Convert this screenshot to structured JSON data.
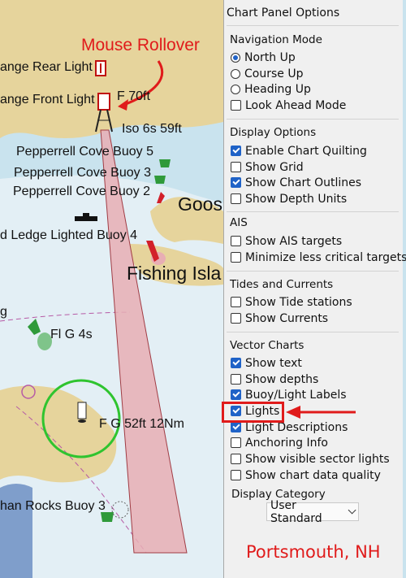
{
  "annotations": {
    "mouse_rollover": "Mouse Rollover",
    "location": "Portsmouth, NH"
  },
  "chart_labels": {
    "range_rear": "ange Rear Light",
    "range_front": "ange Front Light",
    "front_light_char": "F 70ft",
    "iso_char": "Iso 6s 59ft",
    "buoy5": "Pepperrell Cove Buoy 5",
    "buoy3": "Pepperrell Cove Buoy 3",
    "buoy2": "Pepperrell Cove Buoy 2",
    "goose": "Goos",
    "ledge_buoy": "d Ledge Lighted Buoy 4",
    "fishing": "Fishing Isla",
    "g_left": "g",
    "flg": "Fl G 4s",
    "fg52": "F G 52ft 12Nm",
    "rocks_buoy": "han Rocks Buoy 3"
  },
  "panel": {
    "title": "Chart Panel Options",
    "navigation": {
      "heading": "Navigation Mode",
      "options": [
        {
          "label": "North Up",
          "selected": true
        },
        {
          "label": "Course Up",
          "selected": false
        },
        {
          "label": "Heading Up",
          "selected": false
        }
      ],
      "look_ahead": {
        "label": "Look Ahead Mode",
        "checked": false
      }
    },
    "display": {
      "heading": "Display Options",
      "items": [
        {
          "label": "Enable Chart Quilting",
          "checked": true
        },
        {
          "label": "Show Grid",
          "checked": false
        },
        {
          "label": "Show Chart Outlines",
          "checked": true
        },
        {
          "label": "Show Depth Units",
          "checked": false
        }
      ]
    },
    "ais": {
      "heading": "AIS",
      "items": [
        {
          "label": "Show AIS targets",
          "checked": false
        },
        {
          "label": "Minimize less critical targets",
          "checked": false
        }
      ]
    },
    "tides": {
      "heading": "Tides and Currents",
      "items": [
        {
          "label": "Show Tide stations",
          "checked": false
        },
        {
          "label": "Show Currents",
          "checked": false
        }
      ]
    },
    "vector": {
      "heading": "Vector Charts",
      "items": [
        {
          "label": "Show text",
          "checked": true
        },
        {
          "label": "Show depths",
          "checked": false
        },
        {
          "label": "Buoy/Light Labels",
          "checked": true
        },
        {
          "label": "Lights",
          "checked": true
        },
        {
          "label": "Light Descriptions",
          "checked": true
        },
        {
          "label": "Anchoring Info",
          "checked": false
        },
        {
          "label": "Show visible sector lights",
          "checked": false
        },
        {
          "label": "Show chart data quality",
          "checked": false
        }
      ]
    },
    "category": {
      "heading": "Display Category",
      "selected": "User Standard"
    }
  },
  "colors": {
    "land": "#e6d49c",
    "shallow": "#c9e3ee",
    "deep": "#e3eff5",
    "sector": "#e8aeb4",
    "accent_red": "#e01b1b",
    "check_blue": "#1f62c7"
  }
}
